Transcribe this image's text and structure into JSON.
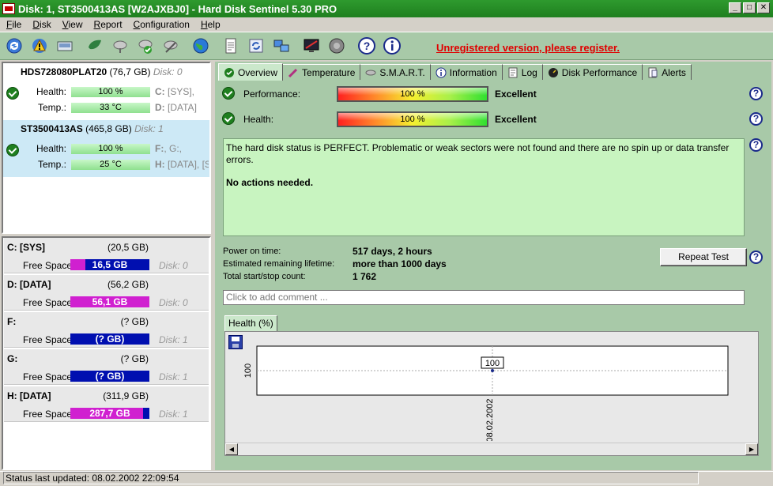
{
  "window": {
    "title": "Disk: 1, ST3500413AS [W2AJXBJ0]  -  Hard Disk Sentinel 5.30 PRO",
    "min": "_",
    "max": "□",
    "close": "✕"
  },
  "menu": [
    {
      "u": "F",
      "rest": "ile"
    },
    {
      "u": "D",
      "rest": "isk"
    },
    {
      "u": "V",
      "rest": "iew"
    },
    {
      "u": "R",
      "rest": "eport"
    },
    {
      "u": "C",
      "rest": "onfiguration"
    },
    {
      "u": "H",
      "rest": "elp"
    }
  ],
  "register_link": "Unregistered version, please register.",
  "disks": [
    {
      "name": "HDS728080PLAT20",
      "size": "(76,7 GB)",
      "disk_label": "Disk: 0",
      "health_label": "Health:",
      "health": "100 %",
      "temp_label": "Temp.:",
      "temp": "33 °C",
      "vol1_letter": "C:",
      "vol1_rest": " [SYS],",
      "vol2_letter": "D:",
      "vol2_rest": " [DATA]"
    },
    {
      "name": "ST3500413AS",
      "size": "(465,8 GB)",
      "disk_label": "Disk: 1",
      "health_label": "Health:",
      "health": "100 %",
      "temp_label": "Temp.:",
      "temp": "25 °C",
      "vol1_letter": "F:",
      "vol1_rest": ", G:,",
      "vol2_letter": "H:",
      "vol2_rest": " [DATA], [S"
    }
  ],
  "volumes": [
    {
      "name": "C: [SYS]",
      "size": "(20,5 GB)",
      "free_label": "Free Space",
      "free": "16,5 GB",
      "fill": 0.19,
      "disk": "Disk: 0"
    },
    {
      "name": "D: [DATA]",
      "size": "(56,2 GB)",
      "free_label": "Free Space",
      "free": "56,1 GB",
      "fill": 1.0,
      "disk": "Disk: 0"
    },
    {
      "name": "F:",
      "size": "(? GB)",
      "free_label": "Free Space",
      "free": "(? GB)",
      "fill": 0,
      "disk": "Disk: 1"
    },
    {
      "name": "G:",
      "size": "(? GB)",
      "free_label": "Free Space",
      "free": "(? GB)",
      "fill": 0,
      "disk": "Disk: 1"
    },
    {
      "name": "H: [DATA]",
      "size": "(311,9 GB)",
      "free_label": "Free Space",
      "free": "287,7 GB",
      "fill": 0.92,
      "disk": "Disk: 1"
    }
  ],
  "tabs": [
    "Overview",
    "Temperature",
    "S.M.A.R.T.",
    "Information",
    "Log",
    "Disk Performance",
    "Alerts"
  ],
  "overview": {
    "performance_label": "Performance:",
    "performance_value": "100 %",
    "performance_rating": "Excellent",
    "health_label": "Health:",
    "health_value": "100 %",
    "health_rating": "Excellent",
    "status_text": "The hard disk status is PERFECT. Problematic or weak sectors were not found and there are no spin up or data transfer errors.",
    "actions_text": "No actions needed.",
    "power_on_label": "Power on time:",
    "power_on_value": "517 days, 2 hours",
    "lifetime_label": "Estimated remaining lifetime:",
    "lifetime_value": "more than 1000 days",
    "startstop_label": "Total start/stop count:",
    "startstop_value": "1 762",
    "repeat_button": "Repeat Test",
    "comment_placeholder": "Click to add comment ...",
    "help_glyph": "?"
  },
  "health_chart_tab": "Health (%)",
  "chart_data": {
    "type": "line",
    "series": [
      {
        "x": [
          "08.02.2002"
        ],
        "values": [
          100
        ]
      }
    ],
    "x": [
      "08.02.2002"
    ],
    "y_tick_labels": [
      "100"
    ],
    "data_labels": [
      "100"
    ]
  },
  "status_bar": "Status last updated: 08.02.2002 22:09:54",
  "colors": {
    "title_green": "#1f7f1f",
    "panel_green": "#a8c9a8",
    "status_green": "#c8f4c0",
    "free_space_blue": "#000fb0",
    "free_space_magenta": "#d020d0",
    "register_red": "#e00000"
  }
}
